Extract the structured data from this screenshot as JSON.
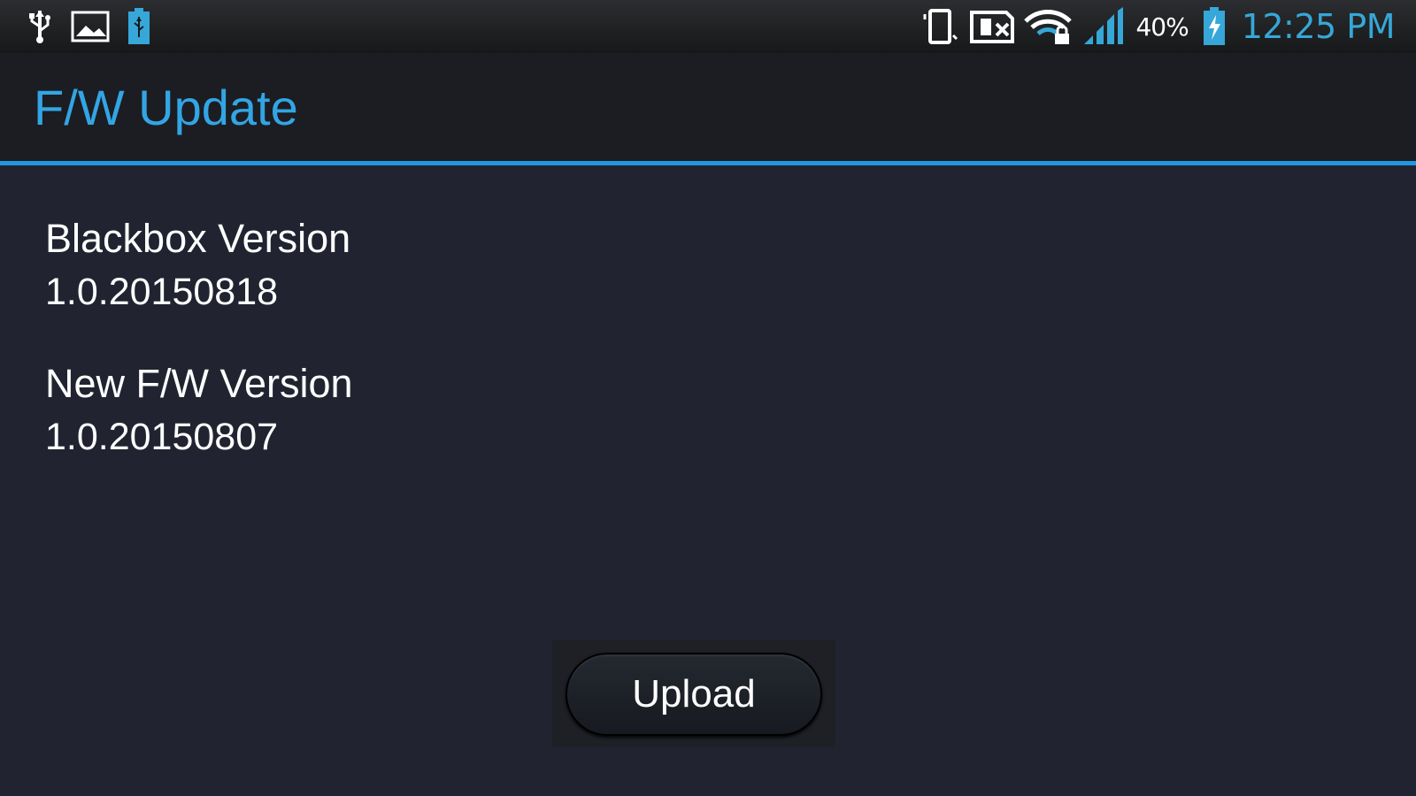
{
  "status_bar": {
    "left_icons": [
      "usb-icon",
      "image-icon",
      "usb-battery-icon"
    ],
    "right_icons": [
      "vibrate-icon",
      "no-sim-icon",
      "wifi-lock-icon",
      "signal-icon",
      "battery-charging-icon"
    ],
    "battery_percent": "40%",
    "time": "12:25 PM",
    "colors": {
      "clock": "#36a7d8",
      "accent": "#33a5e4",
      "icon": "#ffffff"
    }
  },
  "header": {
    "title": "F/W Update"
  },
  "info": {
    "items": [
      {
        "label": "Blackbox Version",
        "value": "1.0.20150818"
      },
      {
        "label": "New F/W Version",
        "value": "1.0.20150807"
      }
    ]
  },
  "actions": {
    "upload_label": "Upload"
  }
}
